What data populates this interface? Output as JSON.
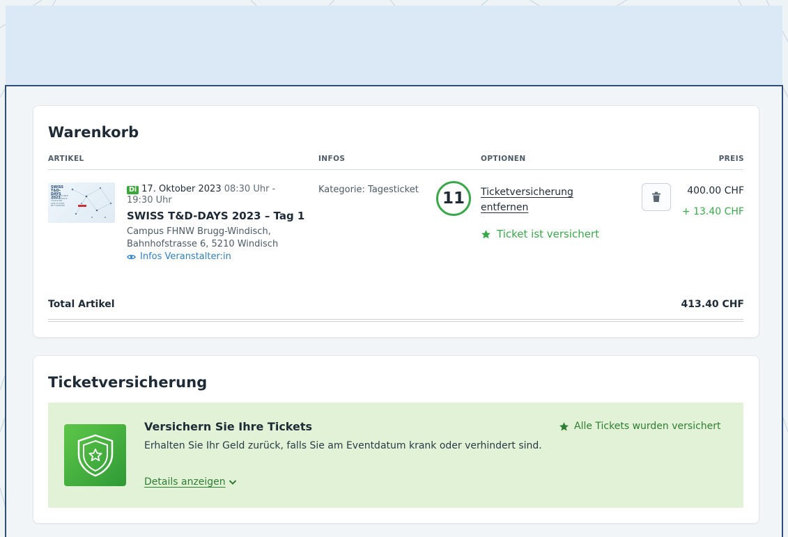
{
  "cart": {
    "title": "Warenkorb",
    "columns": [
      "ARTIKEL",
      "INFOS",
      "OPTIONEN",
      "PREIS"
    ],
    "item": {
      "thumbnail": {
        "line1": "SWISS T&D-DAYS 2023",
        "line2": "24.-26.OKTOBER 2023 · SCIENCE TOGETHER · ONE FUTURE · BE FORWARD"
      },
      "day": "Di",
      "date": "17. Oktober 2023",
      "start_time": "08:30 Uhr -",
      "end_time": "19:30 Uhr",
      "name": "SWISS T&D-DAYS 2023 – Tag 1",
      "venue_line1": "Campus FHNW Brugg-Windisch,",
      "venue_line2": "Bahnhofstrasse 6, 5210 Windisch",
      "organizer_link": "Infos Veranstalter:in",
      "category": "Kategorie: Tagesticket",
      "step_number": "11",
      "remove_insurance_link": "Ticketversicherung entfernen",
      "insured_status": "Ticket ist versichert",
      "price": "400.00 CHF",
      "insurance_price": "+ 13.40 CHF"
    },
    "total_label": "Total Artikel",
    "total_value": "413.40 CHF"
  },
  "insurance": {
    "section_title": "Ticketversicherung",
    "headline": "Versichern Sie Ihre Tickets",
    "description": "Erhalten Sie Ihr Geld zurück, falls Sie am Eventdatum krank oder verhindert sind.",
    "details_link": "Details anzeigen",
    "all_insured": "Alle Tickets wurden versichert"
  },
  "colors": {
    "accent_green": "#3aa84a",
    "link_blue": "#2f7fc4",
    "frame_blue": "#2d4f7a",
    "insurance_bg": "#e1f2d6"
  },
  "icons": [
    "eye-icon",
    "star-icon",
    "trash-icon",
    "shield-star-icon",
    "chevron-down-icon"
  ]
}
